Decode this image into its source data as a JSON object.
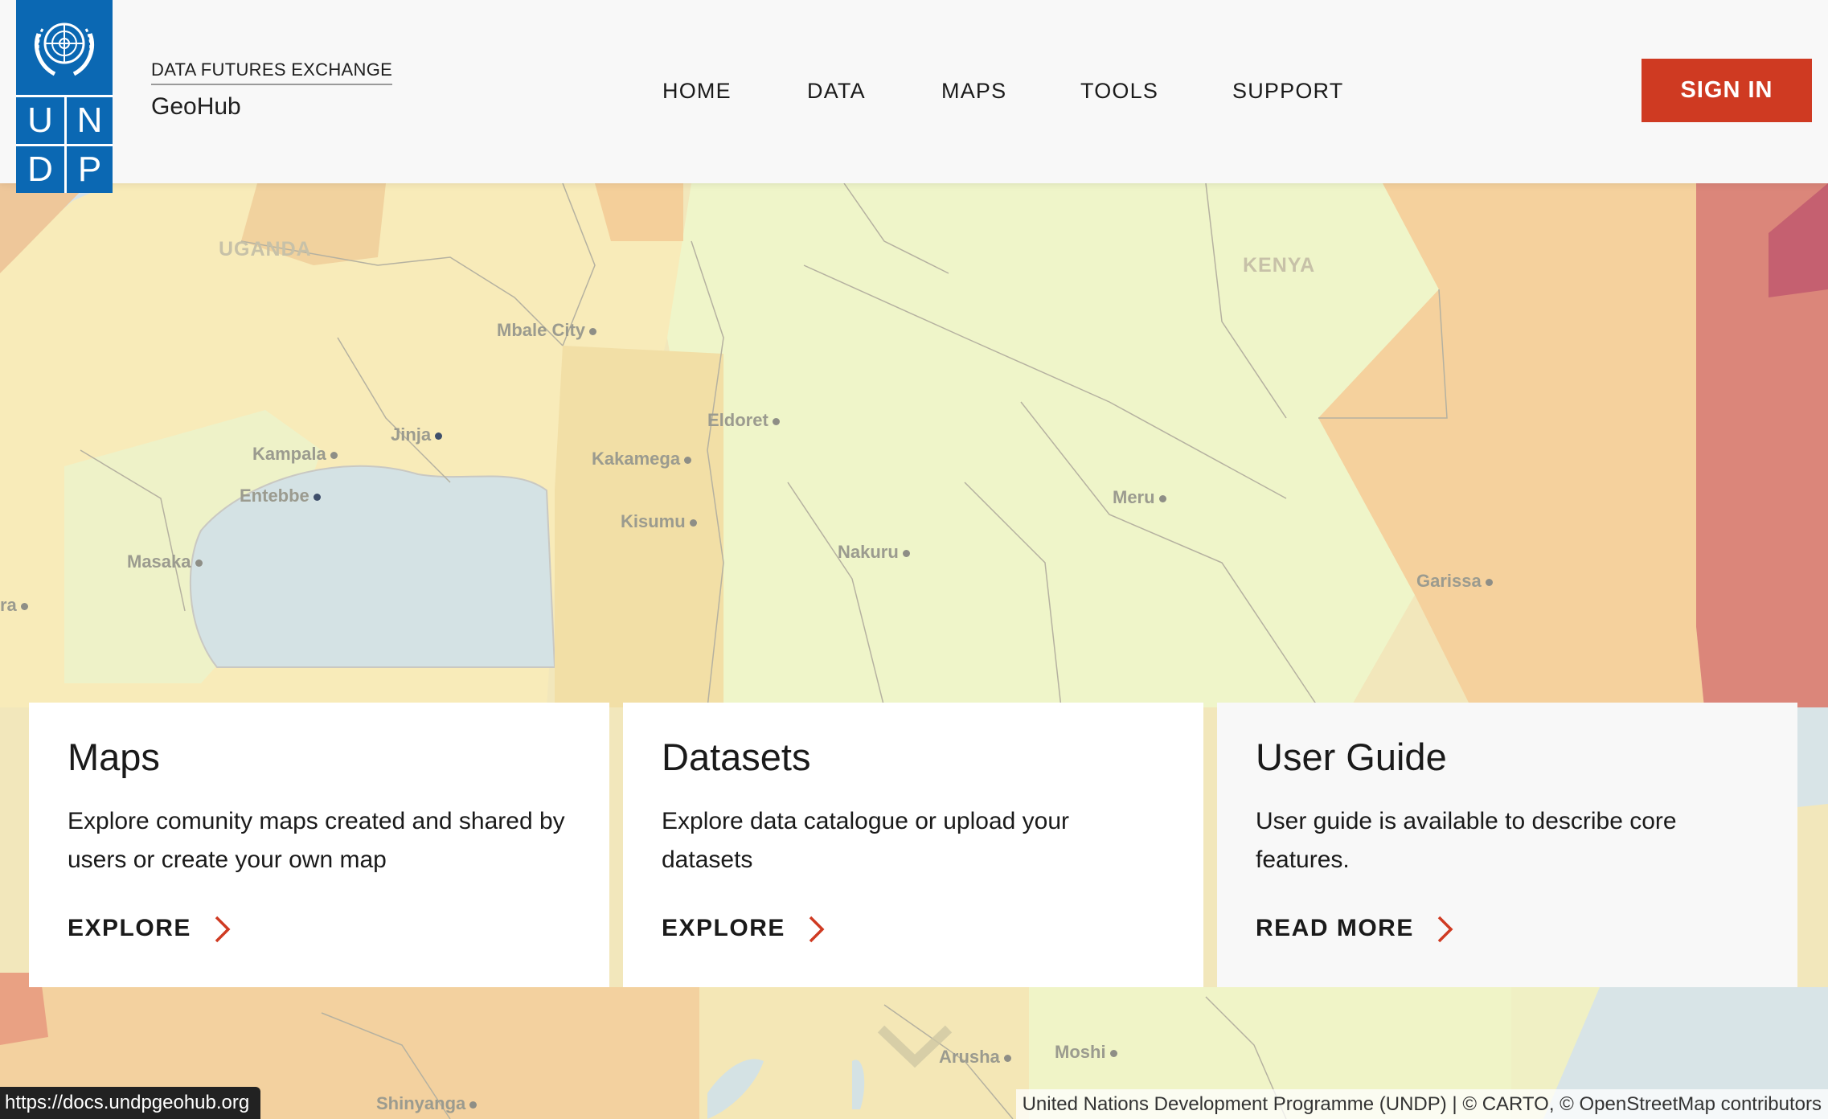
{
  "header": {
    "logo_letters": [
      "U",
      "N",
      "D",
      "P"
    ],
    "brand_top": "DATA FUTURES EXCHANGE",
    "brand_name": "GeoHub",
    "nav": [
      "HOME",
      "DATA",
      "MAPS",
      "TOOLS",
      "SUPPORT"
    ],
    "signin_label": "SIGN IN",
    "accent_color": "#cf3a22",
    "logo_color": "#0b68b3"
  },
  "map": {
    "countries": [
      "UGANDA",
      "KENYA"
    ],
    "cities": [
      "Mbale City",
      "Eldoret",
      "Kampala",
      "Jinja",
      "Kakamega",
      "Entebbe",
      "Kisumu",
      "Meru",
      "Masaka",
      "Nakuru",
      "Garissa",
      "Arusha",
      "Moshi",
      "Shinyanga",
      "ra"
    ]
  },
  "cards": [
    {
      "title": "Maps",
      "text": "Explore comunity maps created and shared by users or create your own map",
      "cta": "EXPLORE"
    },
    {
      "title": "Datasets",
      "text": "Explore data catalogue or upload your datasets",
      "cta": "EXPLORE"
    },
    {
      "title": "User Guide",
      "text": "User guide is available to describe core features.",
      "cta": "READ MORE"
    }
  ],
  "status_url": "https://docs.undpgeohub.org",
  "attribution": "United Nations Development Programme (UNDP) | © CARTO, © OpenStreetMap contributors"
}
